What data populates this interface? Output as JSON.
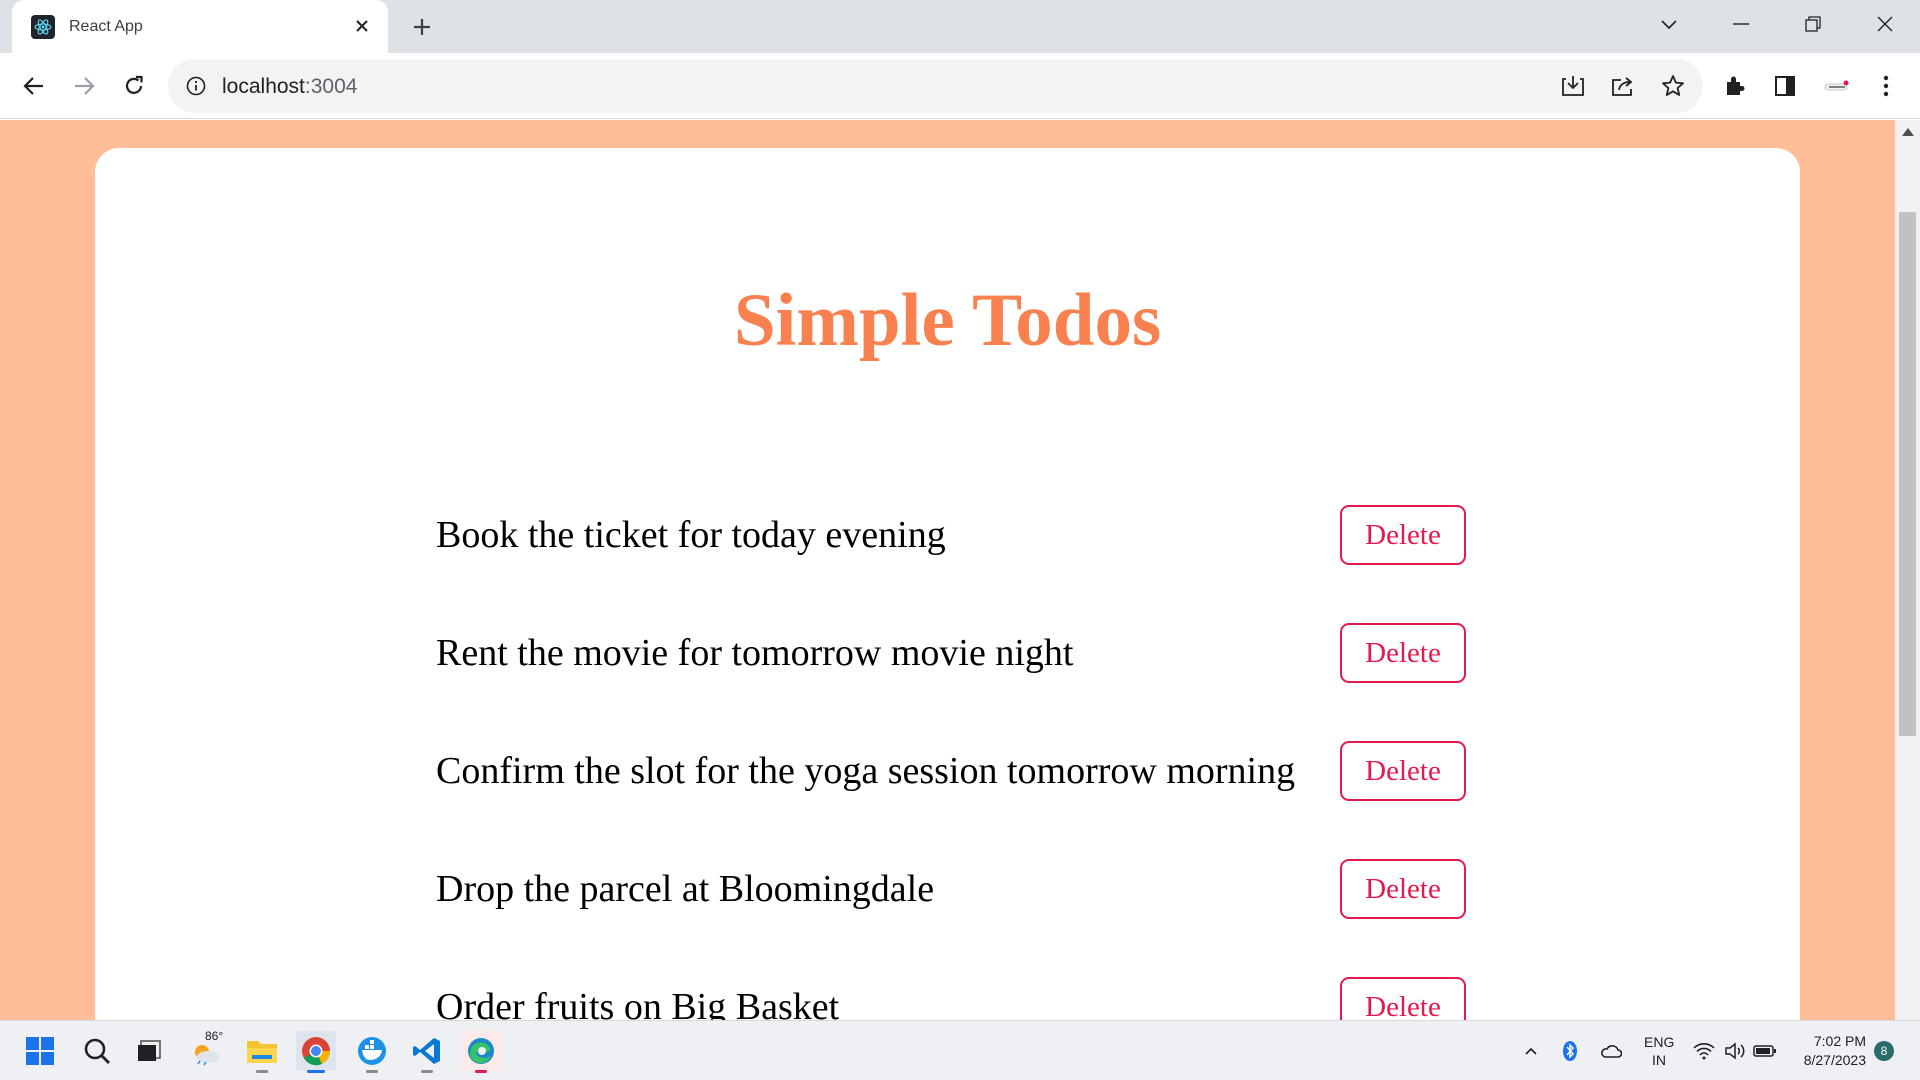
{
  "browser": {
    "tab": {
      "title": "React App",
      "favicon": "react-logo-icon",
      "close": "close-icon"
    },
    "new_tab_icon": "plus-icon",
    "window_controls": [
      "chevron-down-icon",
      "minimize-icon",
      "restore-icon",
      "close-icon"
    ],
    "address": {
      "host": "localhost",
      "port": ":3004",
      "info_icon": "info-icon"
    },
    "omnibox_icons": [
      "install-icon",
      "share-icon",
      "star-icon"
    ],
    "toolbar_icons": [
      "extensions-icon",
      "side-panel-icon",
      "profile-icon",
      "menu-icon"
    ]
  },
  "page": {
    "background": "#ffbe98",
    "accent": "#f9804f",
    "danger": "#e31a4f",
    "heading": "Simple Todos",
    "todos": [
      {
        "text": "Book the ticket for today evening",
        "action": "Delete"
      },
      {
        "text": "Rent the movie for tomorrow movie night",
        "action": "Delete"
      },
      {
        "text": "Confirm the slot for the yoga session tomorrow morning",
        "action": "Delete"
      },
      {
        "text": "Drop the parcel at Bloomingdale",
        "action": "Delete"
      },
      {
        "text": "Order fruits on Big Basket",
        "action": "Delete"
      }
    ]
  },
  "taskbar": {
    "apps": [
      "windows-start-icon",
      "search-icon",
      "task-view-icon",
      "weather-icon",
      "file-explorer-icon",
      "chrome-icon",
      "docker-icon",
      "vscode-icon",
      "edge-icon"
    ],
    "weather_temp": "86°",
    "language": {
      "line1": "ENG",
      "line2": "IN"
    },
    "time": "7:02 PM",
    "date": "8/27/2023",
    "notification_count": "8"
  }
}
